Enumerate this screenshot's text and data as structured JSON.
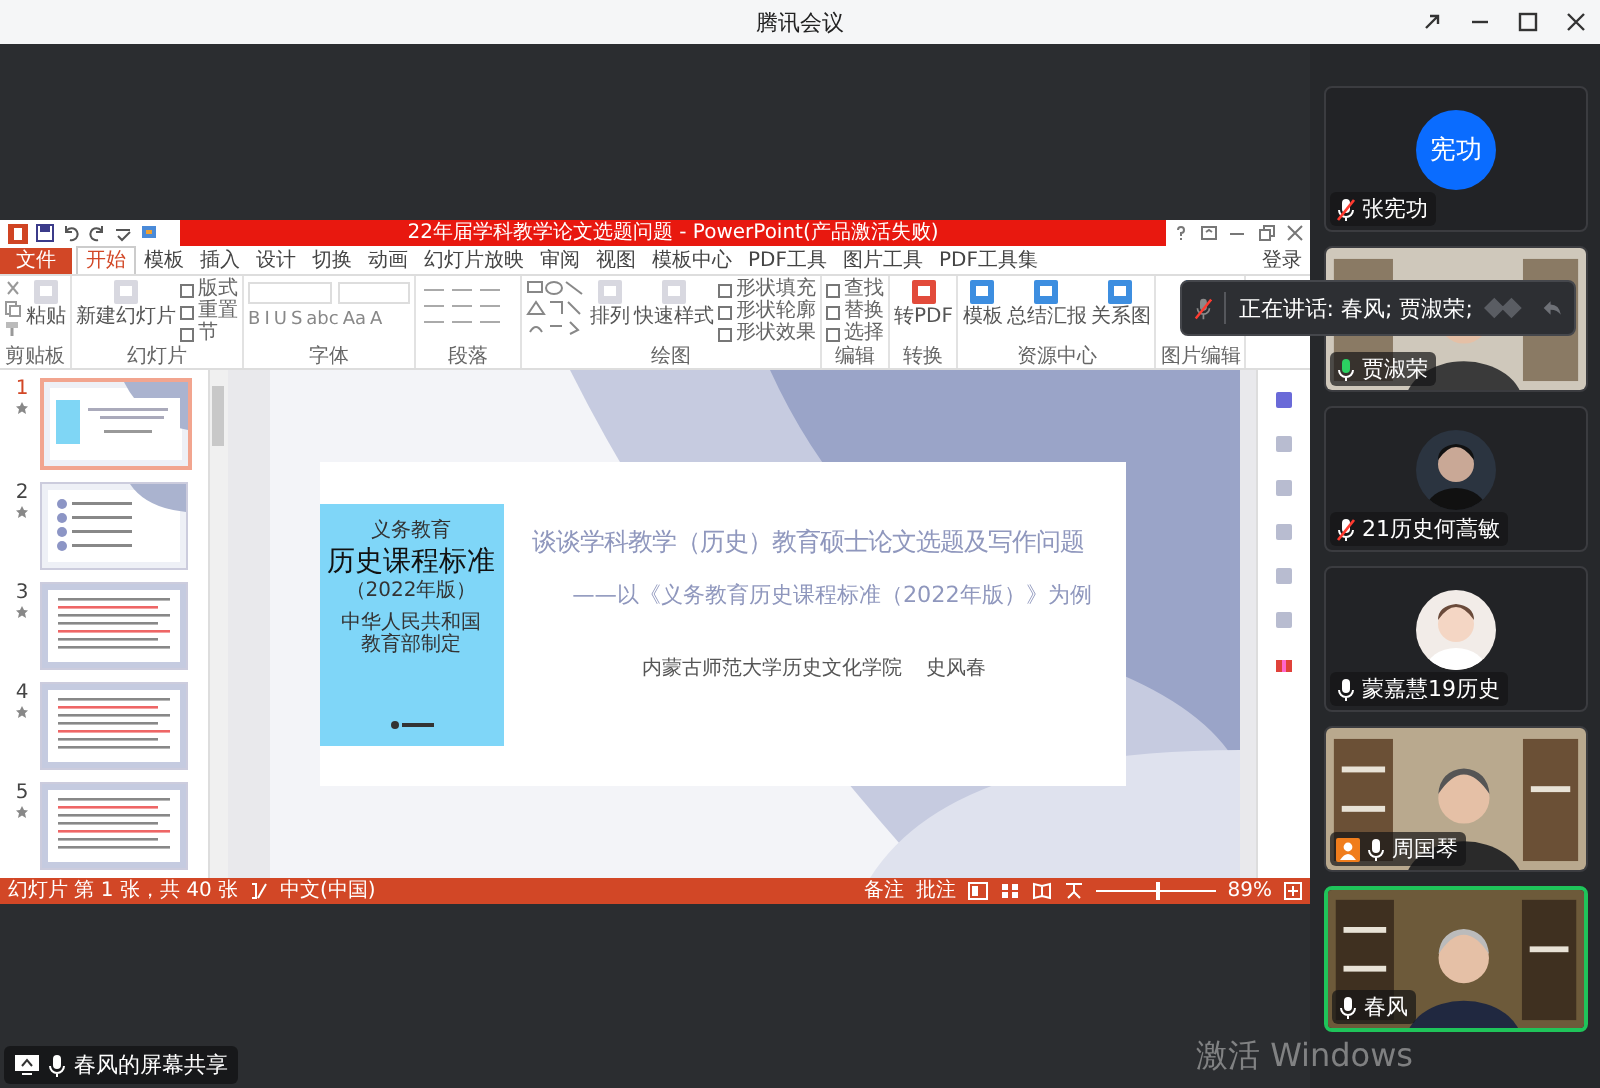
{
  "window": {
    "title": "腾讯会议"
  },
  "ppt": {
    "title": "22年届学科教学论文选题问题 - PowerPoint(产品激活失败)",
    "tabs": [
      {
        "label": "文件",
        "selected": false,
        "kind": "file"
      },
      {
        "label": "开始",
        "selected": true,
        "kind": "tab"
      },
      {
        "label": "模板",
        "selected": false,
        "kind": "tab"
      },
      {
        "label": "插入",
        "selected": false,
        "kind": "tab"
      },
      {
        "label": "设计",
        "selected": false,
        "kind": "tab"
      },
      {
        "label": "切换",
        "selected": false,
        "kind": "tab"
      },
      {
        "label": "动画",
        "selected": false,
        "kind": "tab"
      },
      {
        "label": "幻灯片放映",
        "selected": false,
        "kind": "tab"
      },
      {
        "label": "审阅",
        "selected": false,
        "kind": "tab"
      },
      {
        "label": "视图",
        "selected": false,
        "kind": "tab"
      },
      {
        "label": "模板中心",
        "selected": false,
        "kind": "tab"
      },
      {
        "label": "PDF工具",
        "selected": false,
        "kind": "tab"
      },
      {
        "label": "图片工具",
        "selected": false,
        "kind": "tab"
      },
      {
        "label": "PDF工具集",
        "selected": false,
        "kind": "tab"
      }
    ],
    "sign_in": "登录",
    "ribbon": [
      {
        "kind": "clipboard",
        "label": "剪贴板",
        "buttons": [
          {
            "label": "粘贴",
            "kind": "large"
          }
        ]
      },
      {
        "kind": "slides",
        "label": "幻灯片",
        "buttons": [
          {
            "label": "新建幻灯片",
            "kind": "large"
          },
          {
            "label": "版式",
            "kind": "small"
          },
          {
            "label": "重置",
            "kind": "small"
          },
          {
            "label": "节",
            "kind": "small"
          }
        ]
      },
      {
        "kind": "font",
        "label": "字体",
        "glyphs": [
          "B",
          "I",
          "U",
          "S",
          "abc",
          "Aa",
          "A"
        ]
      },
      {
        "kind": "paragraph",
        "label": "段落"
      },
      {
        "kind": "drawing",
        "label": "绘图",
        "buttons": [
          {
            "label": "排列",
            "kind": "large"
          },
          {
            "label": "快速样式",
            "kind": "large"
          },
          {
            "label": "形状填充",
            "kind": "small"
          },
          {
            "label": "形状轮廓",
            "kind": "small"
          },
          {
            "label": "形状效果",
            "kind": "small"
          }
        ]
      },
      {
        "kind": "editing",
        "label": "编辑",
        "buttons": [
          {
            "label": "查找",
            "kind": "small"
          },
          {
            "label": "替换",
            "kind": "small"
          },
          {
            "label": "选择",
            "kind": "small"
          }
        ]
      },
      {
        "kind": "convert",
        "label": "转换",
        "buttons": [
          {
            "label": "转PDF",
            "kind": "large"
          }
        ]
      },
      {
        "kind": "resources",
        "label": "资源中心",
        "buttons": [
          {
            "label": "模板",
            "kind": "large"
          },
          {
            "label": "总结汇报",
            "kind": "large"
          },
          {
            "label": "关系图",
            "kind": "large"
          }
        ]
      },
      {
        "kind": "picture",
        "label": "图片编辑"
      }
    ],
    "thumbnails": [
      {
        "number": "1",
        "selected": true,
        "kind": "title"
      },
      {
        "number": "2",
        "selected": false,
        "kind": "list"
      },
      {
        "number": "3",
        "selected": false,
        "kind": "text"
      },
      {
        "number": "4",
        "selected": false,
        "kind": "text"
      },
      {
        "number": "5",
        "selected": false,
        "kind": "text"
      }
    ],
    "slide": {
      "cover": {
        "series": "义务教育",
        "title": "历史课程标准",
        "edition": "（2022年版）",
        "issuer": "中华人民共和国教育部制定"
      },
      "title": "谈谈学科教学（历史）教育硕士论文选题及写作问题",
      "subtitle": "——以《义务教育历史课程标准（2022年版）》为例",
      "affiliation": "内蒙古师范大学历史文化学院",
      "author": "史风春"
    },
    "status_bar": {
      "slide_info": "幻灯片 第 1 张，共 40 张",
      "language": "中文(中国)",
      "notes": "备注",
      "comments": "批注",
      "zoom_slider": {
        "level": 0.5
      },
      "zoom": "89%"
    }
  },
  "share_label": "春风的屏幕共享",
  "speaking_banner": "正在讲话: 春风; 贾淑荣;",
  "participants": [
    {
      "name": "张宪功",
      "kind": "avatar",
      "avatar_text": "宪功",
      "muted": true,
      "talking": false,
      "host": false,
      "speaking": false
    },
    {
      "name": "贾淑荣",
      "kind": "video",
      "muted": false,
      "talking": true,
      "host": false,
      "speaking": false
    },
    {
      "name": "21历史何蒿敏",
      "muted": true,
      "talking": false,
      "host": false,
      "speaking": false
    },
    {
      "name": "蒙嘉慧19历史",
      "muted": false,
      "talking": false,
      "host": false,
      "speaking": false
    },
    {
      "name": "周国琴",
      "kind": "video",
      "muted": false,
      "talking": false,
      "host": true,
      "speaking": false
    },
    {
      "name": "春风",
      "kind": "video",
      "muted": false,
      "talking": false,
      "host": false,
      "speaking": true
    }
  ],
  "activation_notice": "激活 Windows"
}
